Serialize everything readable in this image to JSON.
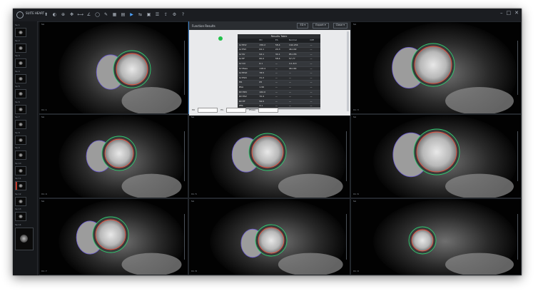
{
  "app": {
    "logo_text": "SUITE HEART"
  },
  "toolbar": {
    "icons": [
      "pointer-icon",
      "window-level-icon",
      "zoom-icon",
      "pan-icon",
      "measure-icon",
      "angle-icon",
      "roi-icon",
      "annotate-icon",
      "layout-icon",
      "grid-icon",
      "cine-icon",
      "sync-icon",
      "mpr-icon",
      "report-icon",
      "export-icon",
      "settings-icon",
      "help-icon"
    ],
    "glyphs": [
      "⬆",
      "◐",
      "⊕",
      "✥",
      "⟷",
      "∠",
      "◯",
      "✎",
      "▦",
      "▤",
      "▶",
      "⇆",
      "▣",
      "☰",
      "⇪",
      "⚙",
      "?"
    ]
  },
  "window_buttons": [
    "–",
    "□",
    "✕"
  ],
  "sidebar": {
    "series": [
      {
        "label": "Se 1",
        "red": false
      },
      {
        "label": "Se 2",
        "red": false
      },
      {
        "label": "Se 3",
        "red": false
      },
      {
        "label": "Se 4",
        "red": false
      },
      {
        "label": "Se 5",
        "red": false
      },
      {
        "label": "Se 6",
        "red": false
      },
      {
        "label": "Se 7",
        "red": false
      },
      {
        "label": "Se 8",
        "red": false
      },
      {
        "label": "Se 9",
        "red": false
      },
      {
        "label": "Se 10",
        "red": false
      },
      {
        "label": "Se 11",
        "red": true
      },
      {
        "label": "Se 12",
        "red": false
      },
      {
        "label": "Se 13",
        "red": false
      },
      {
        "label": "Se 14",
        "red": false
      }
    ]
  },
  "viewports": [
    {
      "tl": "SA",
      "bl": "Im: 1",
      "selected": false
    },
    {
      "tl": "SA",
      "bl": "Im: 2",
      "selected": true
    },
    {
      "tl": "SA",
      "bl": "Im: 3",
      "selected": false
    },
    {
      "tl": "SA",
      "bl": "Im: 4",
      "selected": false
    },
    {
      "tl": "SA",
      "bl": "Im: 5",
      "selected": false
    },
    {
      "tl": "SA",
      "bl": "Im: 6",
      "selected": false
    },
    {
      "tl": "SA",
      "bl": "Im: 7",
      "selected": false
    },
    {
      "tl": "SA",
      "bl": "Im: 8",
      "selected": false
    },
    {
      "tl": "SA",
      "bl": "Im: 9",
      "selected": false
    }
  ],
  "overlay": {
    "title": "Function Results",
    "buttons": [
      "ED ▾",
      "Export ▾",
      "Close ▾"
    ],
    "table_title": "Results Table",
    "headers": [
      "",
      "ED",
      "ES",
      "Normal",
      "Diff"
    ],
    "rows": [
      [
        "LV EDV",
        "156.2",
        "58.4",
        "142-234",
        "—"
      ],
      [
        "LV ESV",
        "62.1",
        "24.3",
        "46-102",
        "—"
      ],
      [
        "LV SV",
        "94.1",
        "34.1",
        "85-155",
        "—"
      ],
      [
        "LV EF",
        "60.2",
        "58.4",
        "57-77",
        "—"
      ],
      [
        "LV CO",
        "6.1",
        "—",
        "4.1-8.3",
        "—"
      ],
      [
        "LV Mass",
        "118.4",
        "—",
        "96-164",
        "—"
      ],
      [
        "LV EDVi",
        "78.5",
        "—",
        "—",
        "—"
      ],
      [
        "LV ESVi",
        "31.2",
        "—",
        "—",
        "—"
      ],
      [
        "HR",
        "65",
        "—",
        "—",
        "—"
      ],
      [
        "BSA",
        "1.99",
        "—",
        "—",
        "—"
      ],
      [
        "RV EDV",
        "162.0",
        "—",
        "—",
        "—"
      ],
      [
        "RV ESV",
        "70.4",
        "—",
        "—",
        "—"
      ],
      [
        "RV EF",
        "56.5",
        "—",
        "—",
        "—"
      ],
      [
        "PFR",
        "3.1",
        "—",
        "—",
        "—"
      ]
    ],
    "footer": [
      "ED",
      "ES",
      "Phase"
    ]
  }
}
